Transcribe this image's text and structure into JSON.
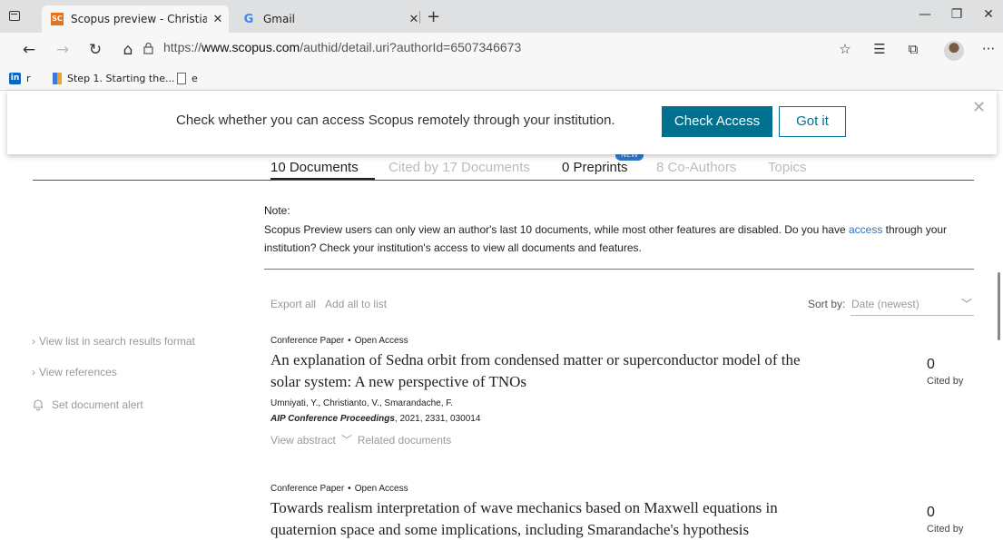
{
  "browser": {
    "tabs": [
      {
        "title": "Scopus preview - Christianto, Vic",
        "favicon": "SC",
        "active": true
      },
      {
        "title": "Gmail",
        "favicon": "G",
        "active": false
      }
    ],
    "url_prefix": "https://",
    "url_host": "www.scopus.com",
    "url_path": "/authid/detail.uri?authorId=6507346673",
    "bookmarks": [
      {
        "label": "r",
        "icon": "linkedin-icon"
      },
      {
        "label": "Step 1. Starting the...",
        "icon": "step-icon"
      },
      {
        "label": "e",
        "icon": "document-icon"
      }
    ]
  },
  "banner": {
    "text": "Check whether you can access Scopus remotely through your institution.",
    "check_access": "Check Access",
    "got_it": "Got it"
  },
  "tabs": {
    "documents": "10 Documents",
    "cited_by": "Cited by 17 Documents",
    "preprints": "0 Preprints",
    "preprints_badge": "NEW",
    "coauthors": "8 Co-Authors",
    "topics": "Topics"
  },
  "note": {
    "title": "Note:",
    "text_before": "Scopus Preview users can only view an author's last 10 documents, while most other features are disabled. Do you have ",
    "link": "access",
    "text_after": " through your institution? Check your institution's access to view all documents and features."
  },
  "toolbar": {
    "export_all": "Export all",
    "add_all": "Add all to list",
    "sort_label": "Sort by:",
    "sort_value": "Date (newest)"
  },
  "sidebar": {
    "view_list": "View list in search results format",
    "view_refs": "View references",
    "set_alert": "Set document alert"
  },
  "documents": [
    {
      "type": "Conference Paper",
      "access": "Open Access",
      "title": "An explanation of Sedna orbit from condensed matter or superconductor model of the solar system: A new perspective of TNOs",
      "authors": "Umniyati, Y., Christianto, V., Smarandache, F.",
      "source_name": "AIP Conference Proceedings",
      "source_rest": ", 2021, 2331, 030014",
      "view_abstract": "View abstract",
      "related": "Related documents",
      "cited_count": "0",
      "cited_label": "Cited by"
    },
    {
      "type": "Conference Paper",
      "access": "Open Access",
      "title": "Towards realism interpretation of wave mechanics based on Maxwell equations in quaternion space and some implications, including Smarandache's hypothesis",
      "cited_count": "0",
      "cited_label": "Cited by"
    }
  ],
  "colors": {
    "accent": "#00718f",
    "link": "#2e6fc0",
    "badge": "#2e7bcf"
  }
}
